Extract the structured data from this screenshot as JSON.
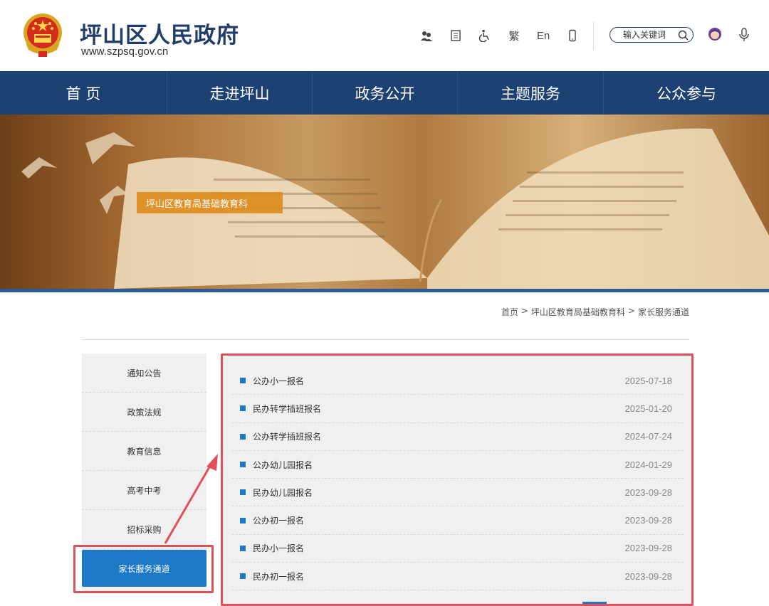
{
  "header": {
    "title": "坪山区人民政府",
    "url": "www.szpsq.gov.cn",
    "tools": [
      {
        "icon": "accessibility-team-icon",
        "label": ""
      },
      {
        "icon": "document-icon",
        "label": ""
      },
      {
        "icon": "wheelchair-icon",
        "label": ""
      },
      {
        "icon": "traditional-chinese",
        "label": "繁"
      },
      {
        "icon": "english",
        "label": "En"
      },
      {
        "icon": "mobile-icon",
        "label": ""
      }
    ],
    "search_placeholder": "输入关键词"
  },
  "nav": {
    "items": [
      "首 页",
      "走进坪山",
      "政务公开",
      "主题服务",
      "公众参与"
    ]
  },
  "banner": {
    "label": "坪山区教育局基础教育科"
  },
  "breadcrumb": {
    "items": [
      "首页",
      "坪山区教育局基础教育科",
      "家长服务通道"
    ],
    "separator": ">"
  },
  "sidebar": {
    "items": [
      "通知公告",
      "政策法规",
      "教育信息",
      "高考中考",
      "招标采购"
    ],
    "active": "家长服务通道"
  },
  "list": {
    "rows": [
      {
        "title": "公办小一报名",
        "date": "2025-07-18"
      },
      {
        "title": "民办转学插班报名",
        "date": "2025-01-20"
      },
      {
        "title": "公办转学插班报名",
        "date": "2024-07-24"
      },
      {
        "title": "公办幼儿园报名",
        "date": "2024-01-29"
      },
      {
        "title": "民办幼儿园报名",
        "date": "2023-09-28"
      },
      {
        "title": "公办初一报名",
        "date": "2023-09-28"
      },
      {
        "title": "民办小一报名",
        "date": "2023-09-28"
      },
      {
        "title": "民办初一报名",
        "date": "2023-09-28"
      }
    ]
  },
  "colors": {
    "nav": "#1e4173",
    "accent": "#1e78c8",
    "highlight": "#e0505a",
    "banner_label": "#de8c1e"
  }
}
